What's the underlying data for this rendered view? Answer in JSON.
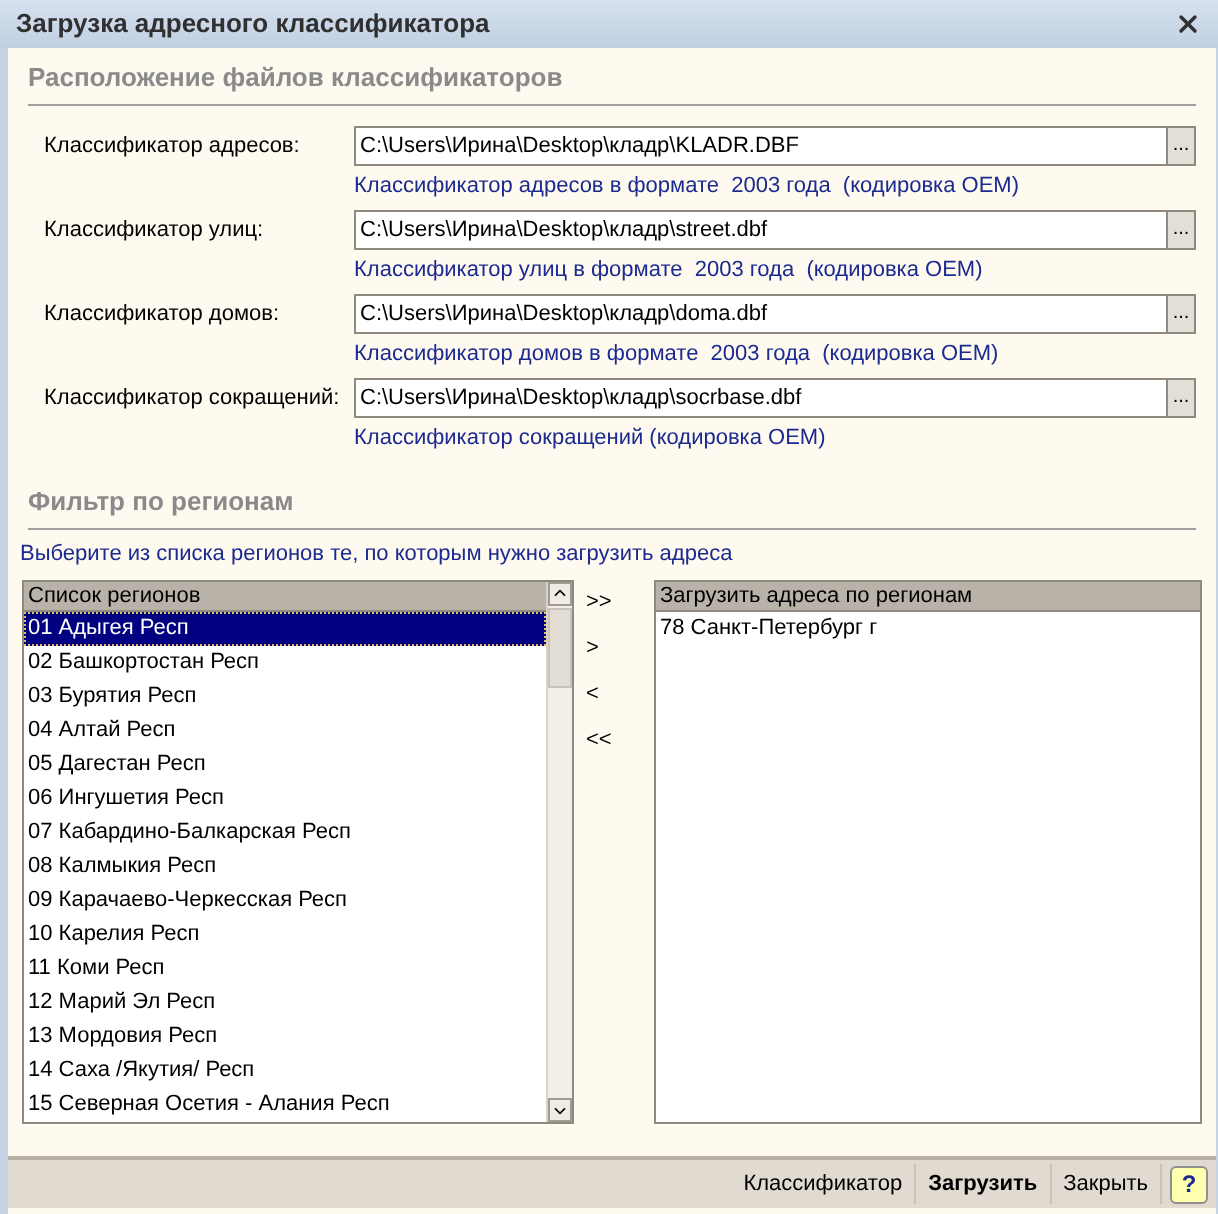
{
  "window": {
    "title": "Загрузка адресного классификатора"
  },
  "files_section": {
    "title": "Расположение файлов классификаторов",
    "rows": [
      {
        "label": "Классификатор адресов:",
        "value": "C:\\Users\\Ирина\\Desktop\\кладр\\KLADR.DBF",
        "button": "...",
        "hint": "Классификатор адресов в формате  2003 года  (кодировка OEM)"
      },
      {
        "label": "Классификатор улиц:",
        "value": "C:\\Users\\Ирина\\Desktop\\кладр\\street.dbf",
        "button": "...",
        "hint": "Классификатор улиц в формате  2003 года  (кодировка OEM)"
      },
      {
        "label": "Классификатор домов:",
        "value": "C:\\Users\\Ирина\\Desktop\\кладр\\doma.dbf",
        "button": "...",
        "hint": "Классификатор домов в формате  2003 года  (кодировка OEM)"
      },
      {
        "label": "Классификатор сокращений:",
        "value": "C:\\Users\\Ирина\\Desktop\\кладр\\socrbase.dbf",
        "button": "...",
        "hint": "Классификатор сокращений (кодировка OEM)"
      }
    ]
  },
  "filter_section": {
    "title": "Фильтр по регионам",
    "instruction": "Выберите из списка регионов те, по которым нужно загрузить адреса",
    "regions_list": {
      "header": "Список регионов",
      "items": [
        {
          "text": "01 Адыгея Респ",
          "selected": true
        },
        {
          "text": "02 Башкортостан Респ",
          "selected": false
        },
        {
          "text": "03 Бурятия Респ",
          "selected": false
        },
        {
          "text": "04 Алтай Респ",
          "selected": false
        },
        {
          "text": "05 Дагестан Респ",
          "selected": false
        },
        {
          "text": "06 Ингушетия Респ",
          "selected": false
        },
        {
          "text": "07 Кабардино-Балкарская Респ",
          "selected": false
        },
        {
          "text": "08 Калмыкия Респ",
          "selected": false
        },
        {
          "text": "09 Карачаево-Черкесская Респ",
          "selected": false
        },
        {
          "text": "10 Карелия Респ",
          "selected": false
        },
        {
          "text": "11 Коми Респ",
          "selected": false
        },
        {
          "text": "12 Марий Эл Респ",
          "selected": false
        },
        {
          "text": "13 Мордовия Респ",
          "selected": false
        },
        {
          "text": "14 Саха /Якутия/ Респ",
          "selected": false
        },
        {
          "text": "15 Северная Осетия - Алания Респ",
          "selected": false
        }
      ]
    },
    "move_buttons": [
      ">>",
      ">",
      "<",
      "<<"
    ],
    "selected_list": {
      "header": "Загрузить адреса по регионам",
      "items": [
        {
          "text": "78 Санкт-Петербург г",
          "selected": false
        }
      ]
    }
  },
  "footer": {
    "buttons": [
      {
        "label": "Классификатор",
        "default": false
      },
      {
        "label": "Загрузить",
        "default": true
      },
      {
        "label": "Закрыть",
        "default": false
      }
    ],
    "help": "?"
  }
}
